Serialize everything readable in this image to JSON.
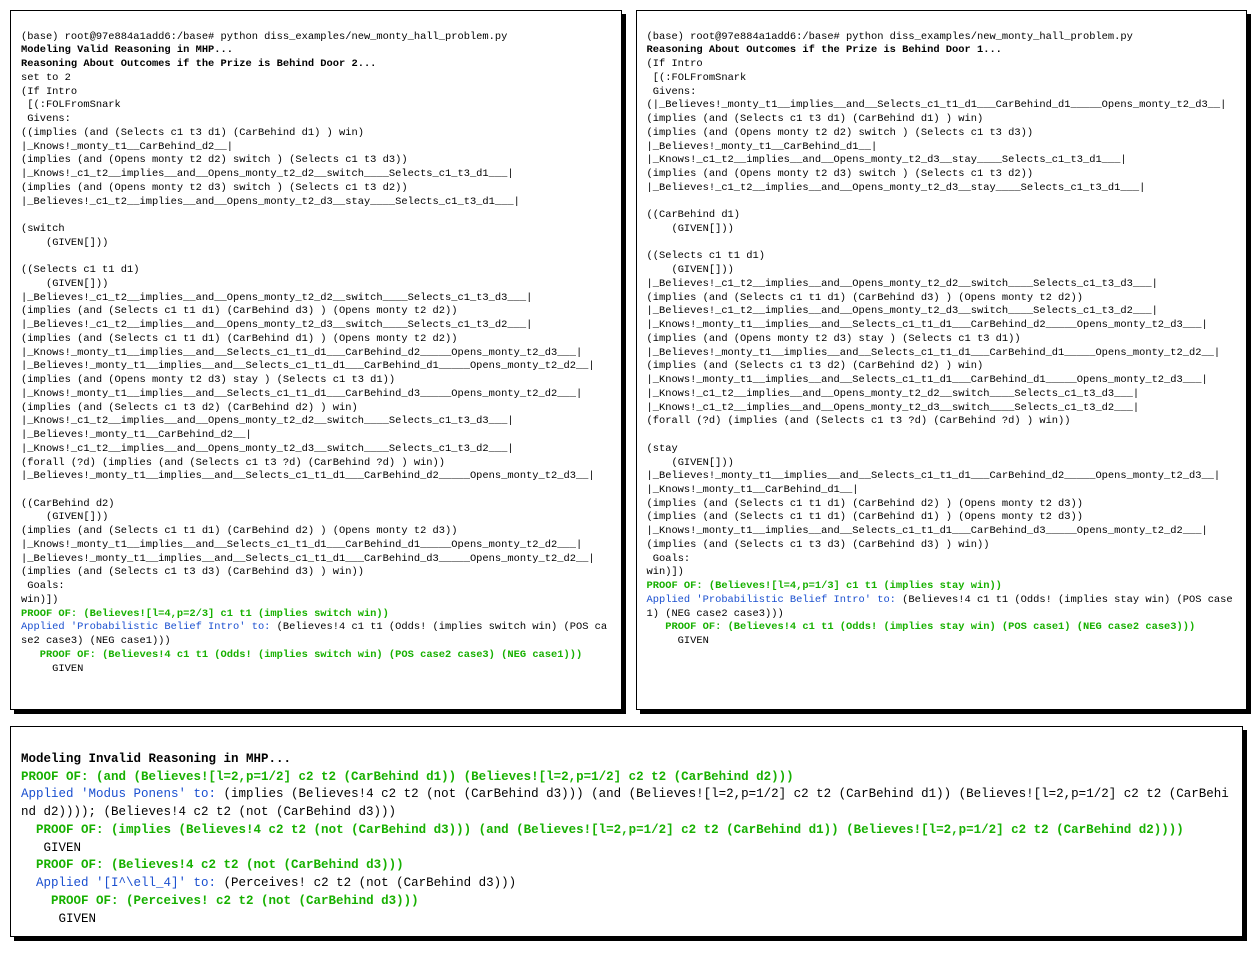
{
  "prompt": "(base) root@97e884a1add6:/base# python diss_examples/new_monty_hall_problem.py",
  "left": {
    "heading1": "Modeling Valid Reasoning in MHP...",
    "heading2": "Reasoning About Outcomes if the Prize is Behind Door 2...",
    "lines": [
      "set to 2",
      "(If Intro",
      " [(:FOLFromSnark",
      " Givens:",
      "((implies (and (Selects c1 t3 d1) (CarBehind d1) ) win)",
      "|_Knows!_monty_t1__CarBehind_d2__|",
      "(implies (and (Opens monty t2 d2) switch ) (Selects c1 t3 d3))",
      "|_Knows!_c1_t2__implies__and__Opens_monty_t2_d2__switch____Selects_c1_t3_d1___|",
      "(implies (and (Opens monty t2 d3) switch ) (Selects c1 t3 d2))",
      "|_Believes!_c1_t2__implies__and__Opens_monty_t2_d3__stay____Selects_c1_t3_d1___|",
      "",
      "(switch",
      "    (GIVEN[]))",
      "",
      "((Selects c1 t1 d1)",
      "    (GIVEN[]))",
      "|_Believes!_c1_t2__implies__and__Opens_monty_t2_d2__switch____Selects_c1_t3_d3___|",
      "(implies (and (Selects c1 t1 d1) (CarBehind d3) ) (Opens monty t2 d2))",
      "|_Believes!_c1_t2__implies__and__Opens_monty_t2_d3__switch____Selects_c1_t3_d2___|",
      "(implies (and (Selects c1 t1 d1) (CarBehind d1) ) (Opens monty t2 d2))",
      "|_Knows!_monty_t1__implies__and__Selects_c1_t1_d1___CarBehind_d2_____Opens_monty_t2_d3___|",
      "|_Believes!_monty_t1__implies__and__Selects_c1_t1_d1___CarBehind_d1_____Opens_monty_t2_d2__|",
      "(implies (and (Opens monty t2 d3) stay ) (Selects c1 t3 d1))",
      "|_Knows!_monty_t1__implies__and__Selects_c1_t1_d1___CarBehind_d3_____Opens_monty_t2_d2___|",
      "(implies (and (Selects c1 t3 d2) (CarBehind d2) ) win)",
      "|_Knows!_c1_t2__implies__and__Opens_monty_t2_d2__switch____Selects_c1_t3_d3___|",
      "|_Believes!_monty_t1__CarBehind_d2__|",
      "|_Knows!_c1_t2__implies__and__Opens_monty_t2_d3__switch____Selects_c1_t3_d2___|",
      "(forall (?d) (implies (and (Selects c1 t3 ?d) (CarBehind ?d) ) win))",
      "|_Believes!_monty_t1__implies__and__Selects_c1_t1_d1___CarBehind_d2_____Opens_monty_t2_d3__|",
      "",
      "((CarBehind d2)",
      "    (GIVEN[]))",
      "(implies (and (Selects c1 t1 d1) (CarBehind d2) ) (Opens monty t2 d3))",
      "|_Knows!_monty_t1__implies__and__Selects_c1_t1_d1___CarBehind_d1_____Opens_monty_t2_d2___|",
      "|_Believes!_monty_t1__implies__and__Selects_c1_t1_d1___CarBehind_d3_____Opens_monty_t2_d2__|",
      "(implies (and (Selects c1 t3 d3) (CarBehind d3) ) win))",
      " Goals:",
      "win)])"
    ],
    "proof1": "PROOF OF: (Believes![l=4,p=2/3] c1 t1 (implies switch win))",
    "applied_kw": "Applied 'Probabilistic Belief Intro' to:",
    "applied_rest": " (Believes!4 c1 t1 (Odds! (implies switch win) (POS case2 case3) (NEG case1)))",
    "proof2": "   PROOF OF: (Believes!4 c1 t1 (Odds! (implies switch win) (POS case2 case3) (NEG case1)))",
    "given": "GIVEN"
  },
  "right": {
    "heading": "Reasoning About Outcomes if the Prize is Behind Door 1...",
    "lines": [
      "(If Intro",
      " [(:FOLFromSnark",
      " Givens:",
      "(|_Believes!_monty_t1__implies__and__Selects_c1_t1_d1___CarBehind_d1_____Opens_monty_t2_d3__|",
      "(implies (and (Selects c1 t3 d1) (CarBehind d1) ) win)",
      "(implies (and (Opens monty t2 d2) switch ) (Selects c1 t3 d3))",
      "|_Believes!_monty_t1__CarBehind_d1__|",
      "|_Knows!_c1_t2__implies__and__Opens_monty_t2_d3__stay____Selects_c1_t3_d1___|",
      "(implies (and (Opens monty t2 d3) switch ) (Selects c1 t3 d2))",
      "|_Believes!_c1_t2__implies__and__Opens_monty_t2_d3__stay____Selects_c1_t3_d1___|",
      "",
      "((CarBehind d1)",
      "    (GIVEN[]))",
      "",
      "((Selects c1 t1 d1)",
      "    (GIVEN[]))",
      "|_Believes!_c1_t2__implies__and__Opens_monty_t2_d2__switch____Selects_c1_t3_d3___|",
      "(implies (and (Selects c1 t1 d1) (CarBehind d3) ) (Opens monty t2 d2))",
      "|_Believes!_c1_t2__implies__and__Opens_monty_t2_d3__switch____Selects_c1_t3_d2___|",
      "|_Knows!_monty_t1__implies__and__Selects_c1_t1_d1___CarBehind_d2_____Opens_monty_t2_d3___|",
      "(implies (and (Opens monty t2 d3) stay ) (Selects c1 t3 d1))",
      "|_Believes!_monty_t1__implies__and__Selects_c1_t1_d1___CarBehind_d1_____Opens_monty_t2_d2__|",
      "(implies (and (Selects c1 t3 d2) (CarBehind d2) ) win)",
      "|_Knows!_monty_t1__implies__and__Selects_c1_t1_d1___CarBehind_d1_____Opens_monty_t2_d3___|",
      "|_Knows!_c1_t2__implies__and__Opens_monty_t2_d2__switch____Selects_c1_t3_d3___|",
      "|_Knows!_c1_t2__implies__and__Opens_monty_t2_d3__switch____Selects_c1_t3_d2___|",
      "(forall (?d) (implies (and (Selects c1 t3 ?d) (CarBehind ?d) ) win))",
      "",
      "(stay",
      "    (GIVEN[]))",
      "|_Believes!_monty_t1__implies__and__Selects_c1_t1_d1___CarBehind_d2_____Opens_monty_t2_d3__|",
      "|_Knows!_monty_t1__CarBehind_d1__|",
      "(implies (and (Selects c1 t1 d1) (CarBehind d2) ) (Opens monty t2 d3))",
      "(implies (and (Selects c1 t1 d1) (CarBehind d1) ) (Opens monty t2 d3))",
      "|_Knows!_monty_t1__implies__and__Selects_c1_t1_d1___CarBehind_d3_____Opens_monty_t2_d2___|",
      "(implies (and (Selects c1 t3 d3) (CarBehind d3) ) win))",
      " Goals:",
      "win)])"
    ],
    "proof1": "PROOF OF: (Believes![l=4,p=1/3] c1 t1 (implies stay win))",
    "applied_kw": "Applied 'Probabilistic Belief Intro' to:",
    "applied_rest": " (Believes!4 c1 t1 (Odds! (implies stay win) (POS case1) (NEG case2 case3)))",
    "proof2": "   PROOF OF: (Believes!4 c1 t1 (Odds! (implies stay win) (POS case1) (NEG case2 case3)))",
    "given": "GIVEN"
  },
  "bottom": {
    "heading": "Modeling Invalid Reasoning in MHP...",
    "proof1": "PROOF OF: (and (Believes![l=2,p=1/2] c2 t2 (CarBehind d1)) (Believes![l=2,p=1/2] c2 t2 (CarBehind d2)))",
    "applied1_kw": "Applied 'Modus Ponens' to:",
    "applied1_rest": " (implies (Believes!4 c2 t2 (not (CarBehind d3))) (and (Believes![l=2,p=1/2] c2 t2 (CarBehind d1)) (Believes![l=2,p=1/2] c2 t2 (CarBehind d2)))); (Believes!4 c2 t2 (not (CarBehind d3)))",
    "proof2": "  PROOF OF: (implies (Believes!4 c2 t2 (not (CarBehind d3))) (and (Believes![l=2,p=1/2] c2 t2 (CarBehind d1)) (Believes![l=2,p=1/2] c2 t2 (CarBehind d2))))",
    "given1": "GIVEN",
    "proof3": "  PROOF OF: (Believes!4 c2 t2 (not (CarBehind d3)))",
    "applied2_kw": "  Applied '[I^\\ell_4]' to:",
    "applied2_rest": " (Perceives! c2 t2 (not (CarBehind d3)))",
    "proof4": "    PROOF OF: (Perceives! c2 t2 (not (CarBehind d3)))",
    "given2": "GIVEN"
  }
}
